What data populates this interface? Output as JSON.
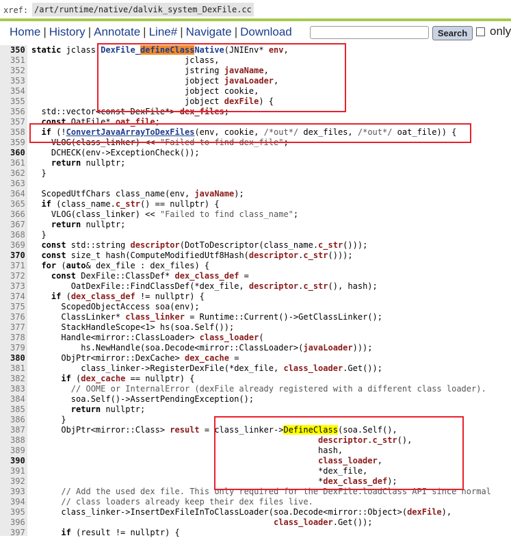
{
  "xref": {
    "label": "xref:",
    "path": "/art/runtime/native/dalvik_system_DexFile.cc"
  },
  "nav": {
    "items": [
      "Home",
      "History",
      "Annotate",
      "Line#",
      "Navigate",
      "Download"
    ],
    "search_button": "Search",
    "only_label": "only"
  },
  "lines": [
    {
      "n": "350",
      "b": true,
      "h": "<span class='k'>static</span> jclass <span class='lnk'>DexFile_<span class='hl-o'>defineClass</span>Native</span>(JNIEnv* <span class='f'>env</span>,"
    },
    {
      "n": "351",
      "h": "                               jclass,"
    },
    {
      "n": "352",
      "h": "                               jstring <span class='f'>javaName</span>,"
    },
    {
      "n": "353",
      "h": "                               jobject <span class='f'>javaLoader</span>,"
    },
    {
      "n": "354",
      "h": "                               jobject cookie,"
    },
    {
      "n": "355",
      "h": "                               jobject <span class='f'>dexFile</span>) {"
    },
    {
      "n": "356",
      "h": "  std::vector&lt;const DexFile*&gt; <span class='f'>dex_files</span>;"
    },
    {
      "n": "357",
      "h": "  <span class='k'>const</span> OatFile* <span class='f'>oat_file</span>;"
    },
    {
      "n": "358",
      "h": "  <span class='k'>if</span> (!<span class='lnk' style='text-decoration:underline'>ConvertJavaArrayToDexFiles</span>(env, cookie, <span class='c'>/*out*/</span> dex_files, <span class='c'>/*out*/</span> oat_file)) {"
    },
    {
      "n": "359",
      "h": "    VLOG(class_linker) &lt;&lt; <span class='s'>\"Failed to find dex_file\"</span>;"
    },
    {
      "n": "360",
      "b": true,
      "h": "    DCHECK(env-&gt;ExceptionCheck());"
    },
    {
      "n": "361",
      "h": "    <span class='k'>return</span> nullptr;"
    },
    {
      "n": "362",
      "h": "  }"
    },
    {
      "n": "363",
      "h": ""
    },
    {
      "n": "364",
      "h": "  ScopedUtfChars class_name(env, <span class='f'>javaName</span>);"
    },
    {
      "n": "365",
      "h": "  <span class='k'>if</span> (class_name.<span class='f'>c_str</span>() == nullptr) {"
    },
    {
      "n": "366",
      "h": "    VLOG(class_linker) &lt;&lt; <span class='s'>\"Failed to find class_name\"</span>;"
    },
    {
      "n": "367",
      "h": "    <span class='k'>return</span> nullptr;"
    },
    {
      "n": "368",
      "h": "  }"
    },
    {
      "n": "369",
      "h": "  <span class='k'>const</span> std::string <span class='f'>descriptor</span>(DotToDescriptor(class_name.<span class='f'>c_str</span>()));"
    },
    {
      "n": "370",
      "b": true,
      "h": "  <span class='k'>const</span> size_t hash(ComputeModifiedUtf8Hash(<span class='f'>descriptor</span>.<span class='f'>c_str</span>()));"
    },
    {
      "n": "371",
      "h": "  <span class='k'>for</span> (<span class='k'>auto</span>&amp; dex_file : dex_files) {"
    },
    {
      "n": "372",
      "h": "    <span class='k'>const</span> DexFile::ClassDef* <span class='f'>dex_class_def</span> ="
    },
    {
      "n": "373",
      "h": "        OatDexFile::FindClassDef(*dex_file, <span class='f'>descriptor</span>.<span class='f'>c_str</span>(), hash);"
    },
    {
      "n": "374",
      "h": "    <span class='k'>if</span> (<span class='f'>dex_class_def</span> != nullptr) {"
    },
    {
      "n": "375",
      "h": "      ScopedObjectAccess soa(env);"
    },
    {
      "n": "376",
      "h": "      ClassLinker* <span class='f'>class_linker</span> = Runtime::Current()-&gt;GetClassLinker();"
    },
    {
      "n": "377",
      "h": "      StackHandleScope&lt;1&gt; hs(soa.Self());"
    },
    {
      "n": "378",
      "h": "      Handle&lt;mirror::ClassLoader&gt; <span class='f'>class_loader</span>("
    },
    {
      "n": "379",
      "h": "          hs.NewHandle(soa.Decode&lt;mirror::ClassLoader&gt;(<span class='f'>javaLoader</span>)));"
    },
    {
      "n": "380",
      "b": true,
      "h": "      ObjPtr&lt;mirror::DexCache&gt; <span class='f'>dex_cache</span> ="
    },
    {
      "n": "381",
      "h": "          class_linker-&gt;RegisterDexFile(*dex_file, <span class='f'>class_loader</span>.Get());"
    },
    {
      "n": "382",
      "h": "      <span class='k'>if</span> (<span class='f'>dex_cache</span> == nullptr) {"
    },
    {
      "n": "383",
      "h": "        <span class='c'>// OOME or InternalError (dexFile already registered with a different class loader).</span>"
    },
    {
      "n": "384",
      "h": "        soa.Self()-&gt;AssertPendingException();"
    },
    {
      "n": "385",
      "h": "        <span class='k'>return</span> nullptr;"
    },
    {
      "n": "386",
      "h": "      }"
    },
    {
      "n": "387",
      "h": "      ObjPtr&lt;mirror::Class&gt; <span class='f'>result</span> = class_linker-&gt;<span class='hl-y'>DefineClass</span>(soa.Self(),"
    },
    {
      "n": "388",
      "h": "                                                          <span class='f'>descriptor</span>.<span class='f'>c_str</span>(),"
    },
    {
      "n": "389",
      "h": "                                                          hash,"
    },
    {
      "n": "390",
      "b": true,
      "h": "                                                          <span class='f'>class_loader</span>,"
    },
    {
      "n": "391",
      "h": "                                                          *dex_file,"
    },
    {
      "n": "392",
      "h": "                                                          *<span class='f'>dex_class_def</span>);"
    },
    {
      "n": "393",
      "h": "      <span class='c'>// Add the used dex file. This only required for the DexFile.loadClass API since normal</span>"
    },
    {
      "n": "394",
      "h": "      <span class='c'>// class loaders already keep their dex files live.</span>"
    },
    {
      "n": "395",
      "h": "      class_linker-&gt;InsertDexFileInToClassLoader(soa.Decode&lt;mirror::Object&gt;(<span class='f'>dexFile</span>),"
    },
    {
      "n": "396",
      "h": "                                                 <span class='f'>class_loader</span>.Get());"
    },
    {
      "n": "397",
      "h": "      <span class='k'>if</span> (result != nullptr) {"
    }
  ]
}
